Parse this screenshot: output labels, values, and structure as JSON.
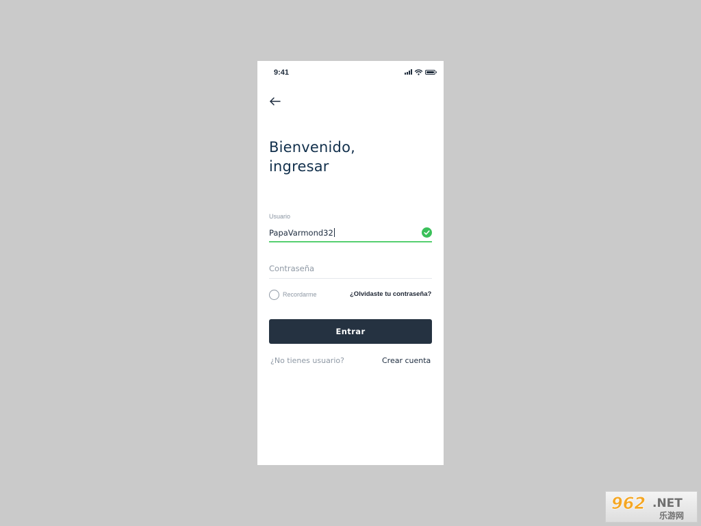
{
  "status_bar": {
    "time": "9:41",
    "icons": [
      "signal-icon",
      "wifi-icon",
      "battery-icon"
    ]
  },
  "navigation": {
    "back_icon": "arrow-left-icon"
  },
  "header": {
    "title_line1": "Bienvenido,",
    "title_line2": "ingresar"
  },
  "form": {
    "username": {
      "label": "Usuario",
      "value": "PapaVarmond32",
      "valid": true,
      "status_icon": "check-circle-icon"
    },
    "password": {
      "placeholder": "Contraseña",
      "value": ""
    },
    "remember": {
      "label": "Recordarme",
      "checked": false
    },
    "forgot_link": "¿Olvidaste tu contraseña?",
    "submit_label": "Entrar"
  },
  "footer": {
    "prompt": "¿No tienes usuario?",
    "create_link": "Crear cuenta"
  },
  "watermark": {
    "logo": "962.NET 乐游网"
  },
  "colors": {
    "background": "#cacaca",
    "screen": "#ffffff",
    "title": "#12304c",
    "text": "#1b2a3d",
    "muted": "#8e98a4",
    "success": "#3ac05a",
    "success_underline": "#55cf6f",
    "button": "#253241"
  }
}
